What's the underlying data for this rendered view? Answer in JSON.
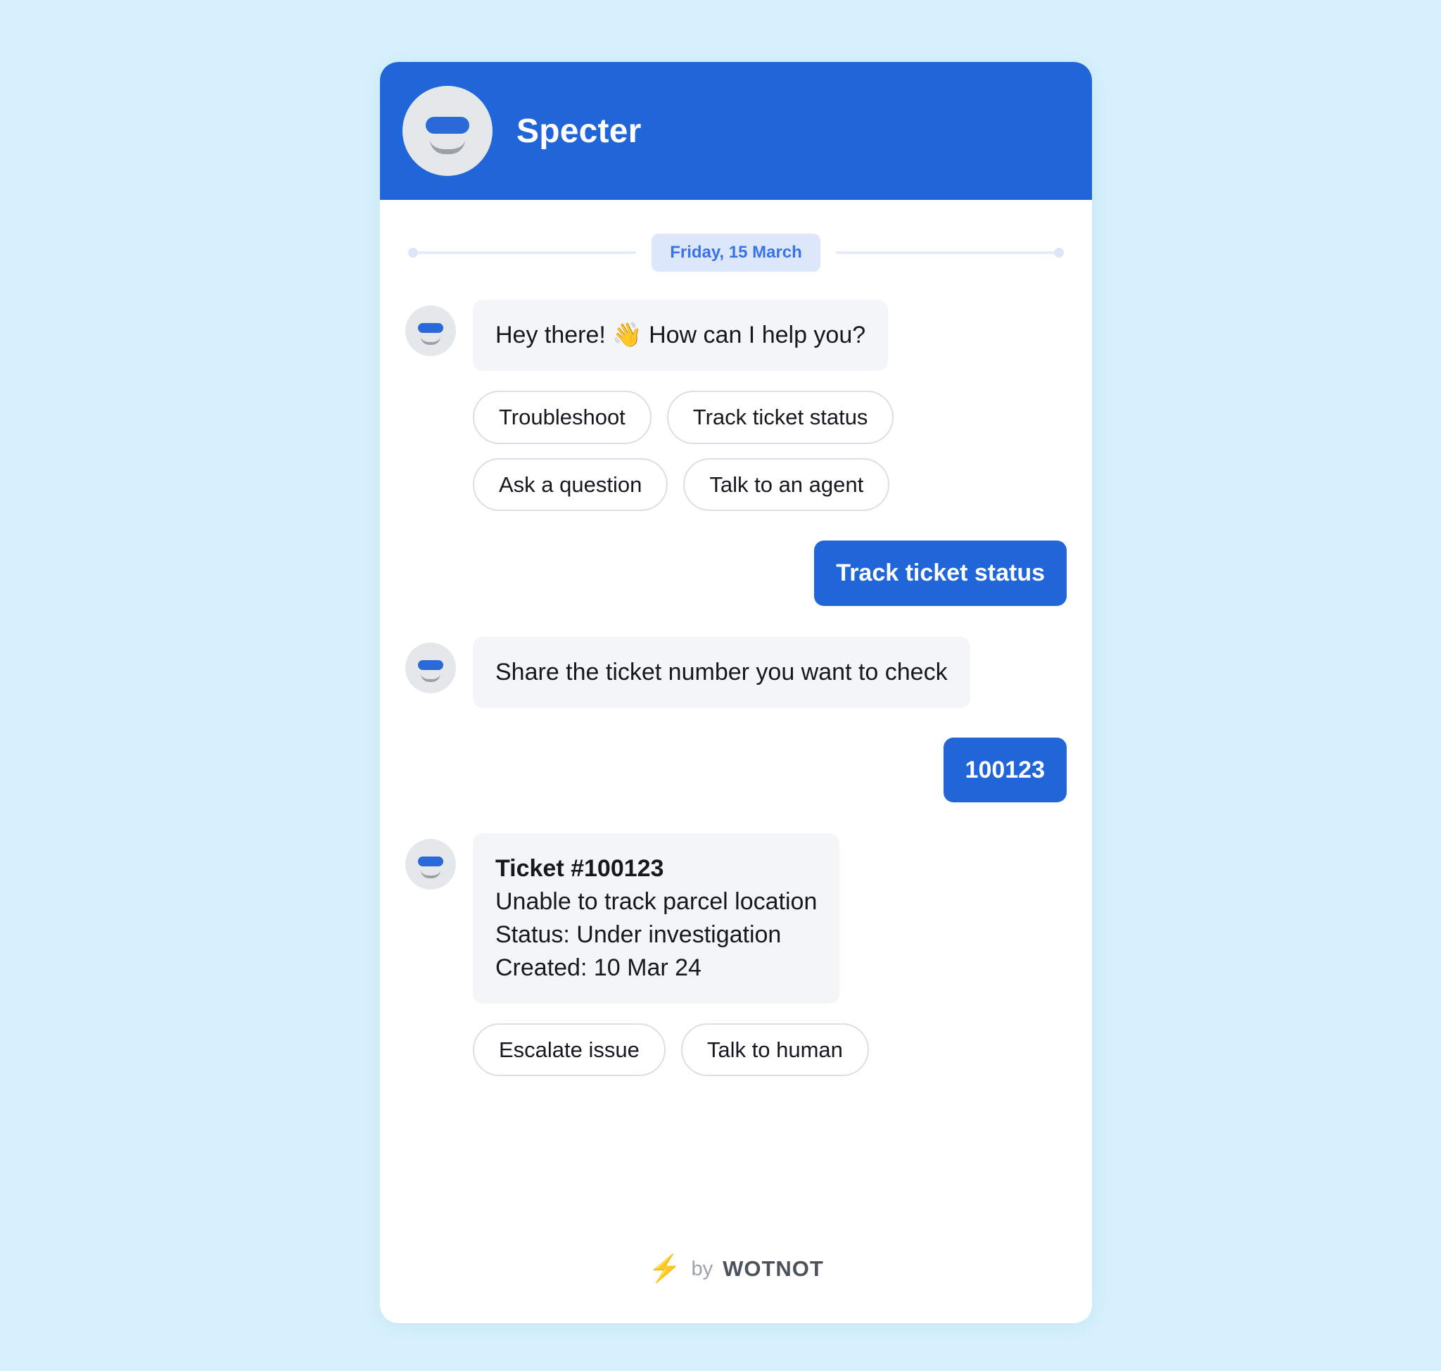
{
  "background_color": "#d6f1fb",
  "widget": {
    "header": {
      "bot_name": "Specter",
      "avatar_icon": "bot-avatar-icon",
      "background_color": "#2166d9"
    },
    "date_divider": {
      "label": "Friday, 15 March",
      "pill_bg": "#dce7fb",
      "pill_text_color": "#3a73e8"
    },
    "conversation": [
      {
        "id": "greeting",
        "sender": "bot",
        "text": "Hey there! 👋 How can I help you?"
      },
      {
        "id": "greeting-options",
        "sender": "bot",
        "type": "quick-replies",
        "options": [
          "Troubleshoot",
          "Track ticket status",
          "Ask a question",
          "Talk to an agent"
        ]
      },
      {
        "id": "user-choice",
        "sender": "user",
        "text": "Track ticket status"
      },
      {
        "id": "ask-ticket-number",
        "sender": "bot",
        "text": "Share the ticket number you want to check"
      },
      {
        "id": "user-ticket-number",
        "sender": "user",
        "text": "100123"
      },
      {
        "id": "ticket-details",
        "sender": "bot",
        "type": "ticket-card",
        "title": "Ticket #100123",
        "subject": "Unable to track parcel location",
        "status": "Status: Under investigation",
        "created": "Created: 10 Mar 24"
      },
      {
        "id": "ticket-options",
        "sender": "bot",
        "type": "quick-replies",
        "options": [
          "Escalate issue",
          "Talk to human"
        ]
      }
    ],
    "footer": {
      "bolt_icon": "⚡",
      "by_label": "by",
      "brand": "WOTNOT"
    }
  }
}
